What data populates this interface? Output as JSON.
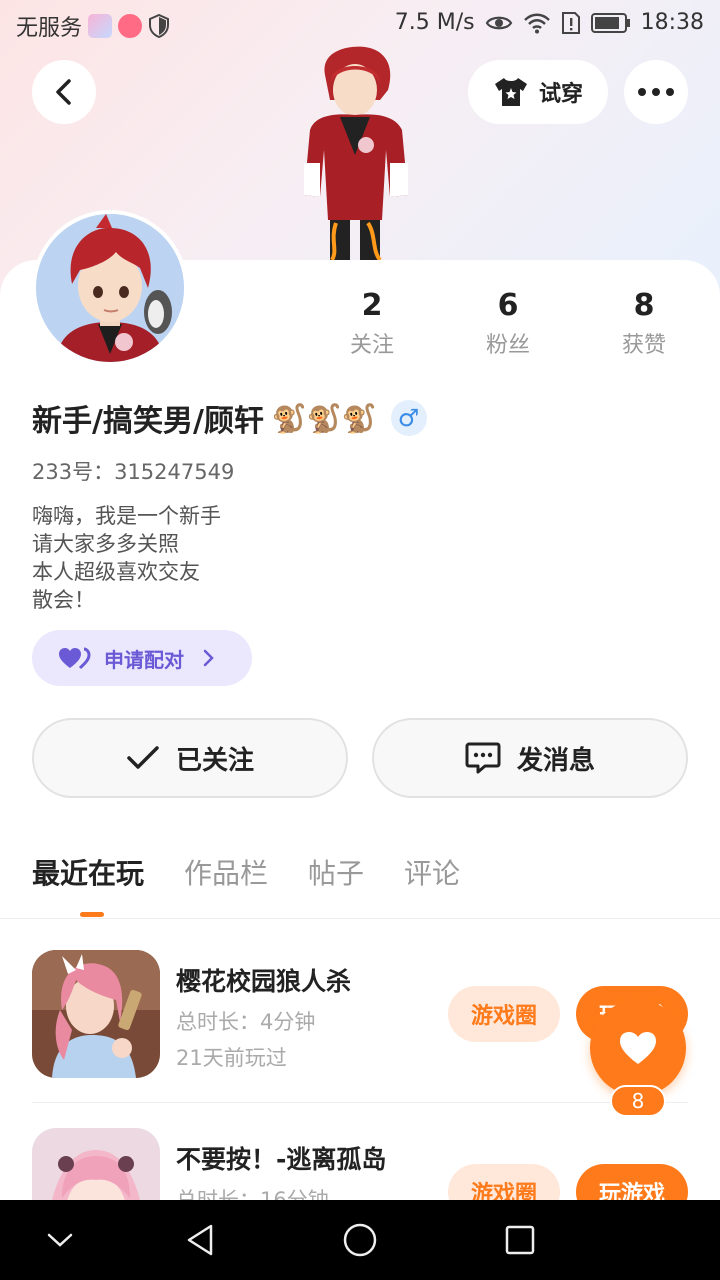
{
  "status_bar": {
    "carrier": "无服务",
    "speed": "7.5 M/s",
    "time": "18:38"
  },
  "header": {
    "try_on_label": "试穿"
  },
  "profile": {
    "stats": [
      {
        "value": "2",
        "label": "关注"
      },
      {
        "value": "6",
        "label": "粉丝"
      },
      {
        "value": "8",
        "label": "获赞"
      }
    ],
    "name": "新手/搞笑男/顾轩",
    "name_emoji": "🐒🐒🐒",
    "gender_symbol": "♂",
    "uid": "233号：315247549",
    "bio": [
      "嗨嗨，我是一个新手",
      "请大家多多关照",
      "本人超级喜欢交友",
      "散会！"
    ],
    "match_label": "申请配对"
  },
  "actions": {
    "follow_label": "已关注",
    "message_label": "发消息"
  },
  "tabs": [
    "最近在玩",
    "作品栏",
    "帖子",
    "评论"
  ],
  "games": [
    {
      "title": "樱花校园狼人杀",
      "duration": "总时长：4分钟",
      "last_played": "21天前玩过",
      "circle_label": "游戏圈",
      "play_label": "玩游戏"
    },
    {
      "title": "不要按！-逃离孤岛",
      "duration": "总时长：16分钟",
      "circle_label": "游戏圈",
      "play_label": "玩游戏"
    }
  ],
  "floating_like": {
    "count": "8"
  },
  "colors": {
    "accent": "#ff7a1a",
    "match_purple": "#6a5ad6",
    "gender_blue": "#3a8ce6"
  }
}
